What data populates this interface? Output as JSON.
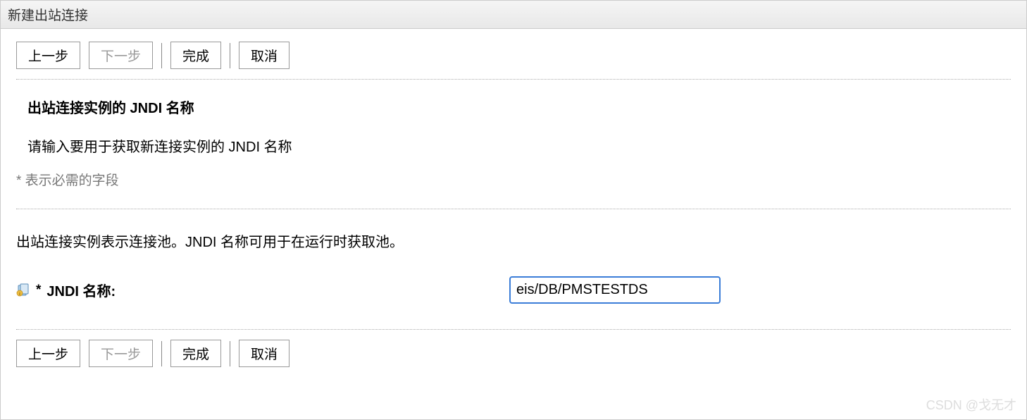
{
  "header": {
    "title": "新建出站连接"
  },
  "buttons": {
    "back": "上一步",
    "next": "下一步",
    "finish": "完成",
    "cancel": "取消"
  },
  "section": {
    "title": "出站连接实例的 JNDI 名称",
    "instruction": "请输入要用于获取新连接实例的 JNDI 名称",
    "required_note": "* 表示必需的字段",
    "description": "出站连接实例表示连接池。JNDI 名称可用于在运行时获取池。"
  },
  "field": {
    "label": "JNDI 名称:",
    "value": "eis/DB/PMSTESTDS"
  },
  "watermark": "CSDN @戈无才"
}
